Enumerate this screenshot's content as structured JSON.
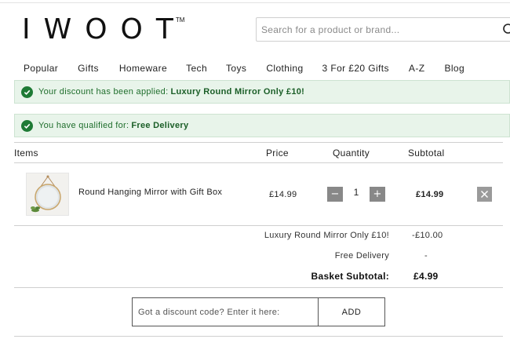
{
  "header": {
    "logo_text": "IWOOT",
    "logo_tm": "TM",
    "search_placeholder": "Search for a product or brand..."
  },
  "nav": {
    "items": [
      {
        "label": "Popular"
      },
      {
        "label": "Gifts"
      },
      {
        "label": "Homeware"
      },
      {
        "label": "Tech"
      },
      {
        "label": "Toys"
      },
      {
        "label": "Clothing"
      },
      {
        "label": "3 For £20 Gifts"
      },
      {
        "label": "A-Z"
      },
      {
        "label": "Blog"
      }
    ]
  },
  "notices": [
    {
      "prefix": "Your discount has been applied:",
      "highlight": "Luxury Round Mirror Only £10!"
    },
    {
      "prefix": "You have qualified for:",
      "highlight": "Free Delivery"
    }
  ],
  "basket": {
    "columns": {
      "items": "Items",
      "price": "Price",
      "quantity": "Quantity",
      "subtotal": "Subtotal"
    },
    "rows": [
      {
        "name": "Round Hanging Mirror with Gift Box",
        "price": "£14.99",
        "quantity": "1",
        "subtotal": "£14.99",
        "minus": "−",
        "plus": "+"
      }
    ],
    "summary": {
      "discount_label": "Luxury Round Mirror Only £10!",
      "discount_value": "-£10.00",
      "delivery_label": "Free Delivery",
      "delivery_value": "-",
      "subtotal_label": "Basket Subtotal:",
      "subtotal_value": "£4.99"
    }
  },
  "discount_code": {
    "placeholder": "Got a discount code? Enter it here:",
    "button_label": "ADD"
  },
  "colors": {
    "success_bg": "#e8f4ea",
    "success_text": "#1f6e2c",
    "success_icon": "#1e7a35",
    "button_grey": "#888888"
  }
}
